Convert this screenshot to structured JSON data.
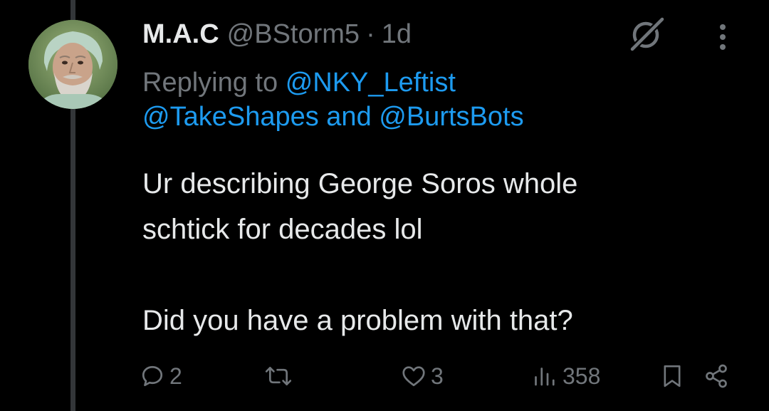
{
  "tweet": {
    "author": {
      "display_name": "M.A.C",
      "handle": "@BStorm5",
      "separator": "·",
      "time": "1d",
      "avatar": "user-avatar-photo"
    },
    "reply": {
      "prefix": "Replying to",
      "mention_1": "@NKY_Leftist",
      "mention_2": "@TakeShapes",
      "conjunction": "and",
      "mention_3": "@BurtsBots"
    },
    "text_line_1": "Ur describing George Soros whole",
    "text_line_2": "schtick for decades lol",
    "text_line_3": "Did you have a problem with that?",
    "stats": {
      "replies": "2",
      "reposts": "",
      "likes": "3",
      "views": "358"
    }
  },
  "icons": {
    "grok": "grok-icon",
    "more": "more-options-icon",
    "reply": "reply-icon",
    "repost": "repost-icon",
    "like": "heart-icon",
    "views": "views-chart-icon",
    "bookmark": "bookmark-icon",
    "share": "share-icon"
  },
  "colors": {
    "background": "#000000",
    "text_primary": "#e7e9ea",
    "text_secondary": "#71767b",
    "accent": "#1d9bf0",
    "thread_line": "#333639"
  }
}
